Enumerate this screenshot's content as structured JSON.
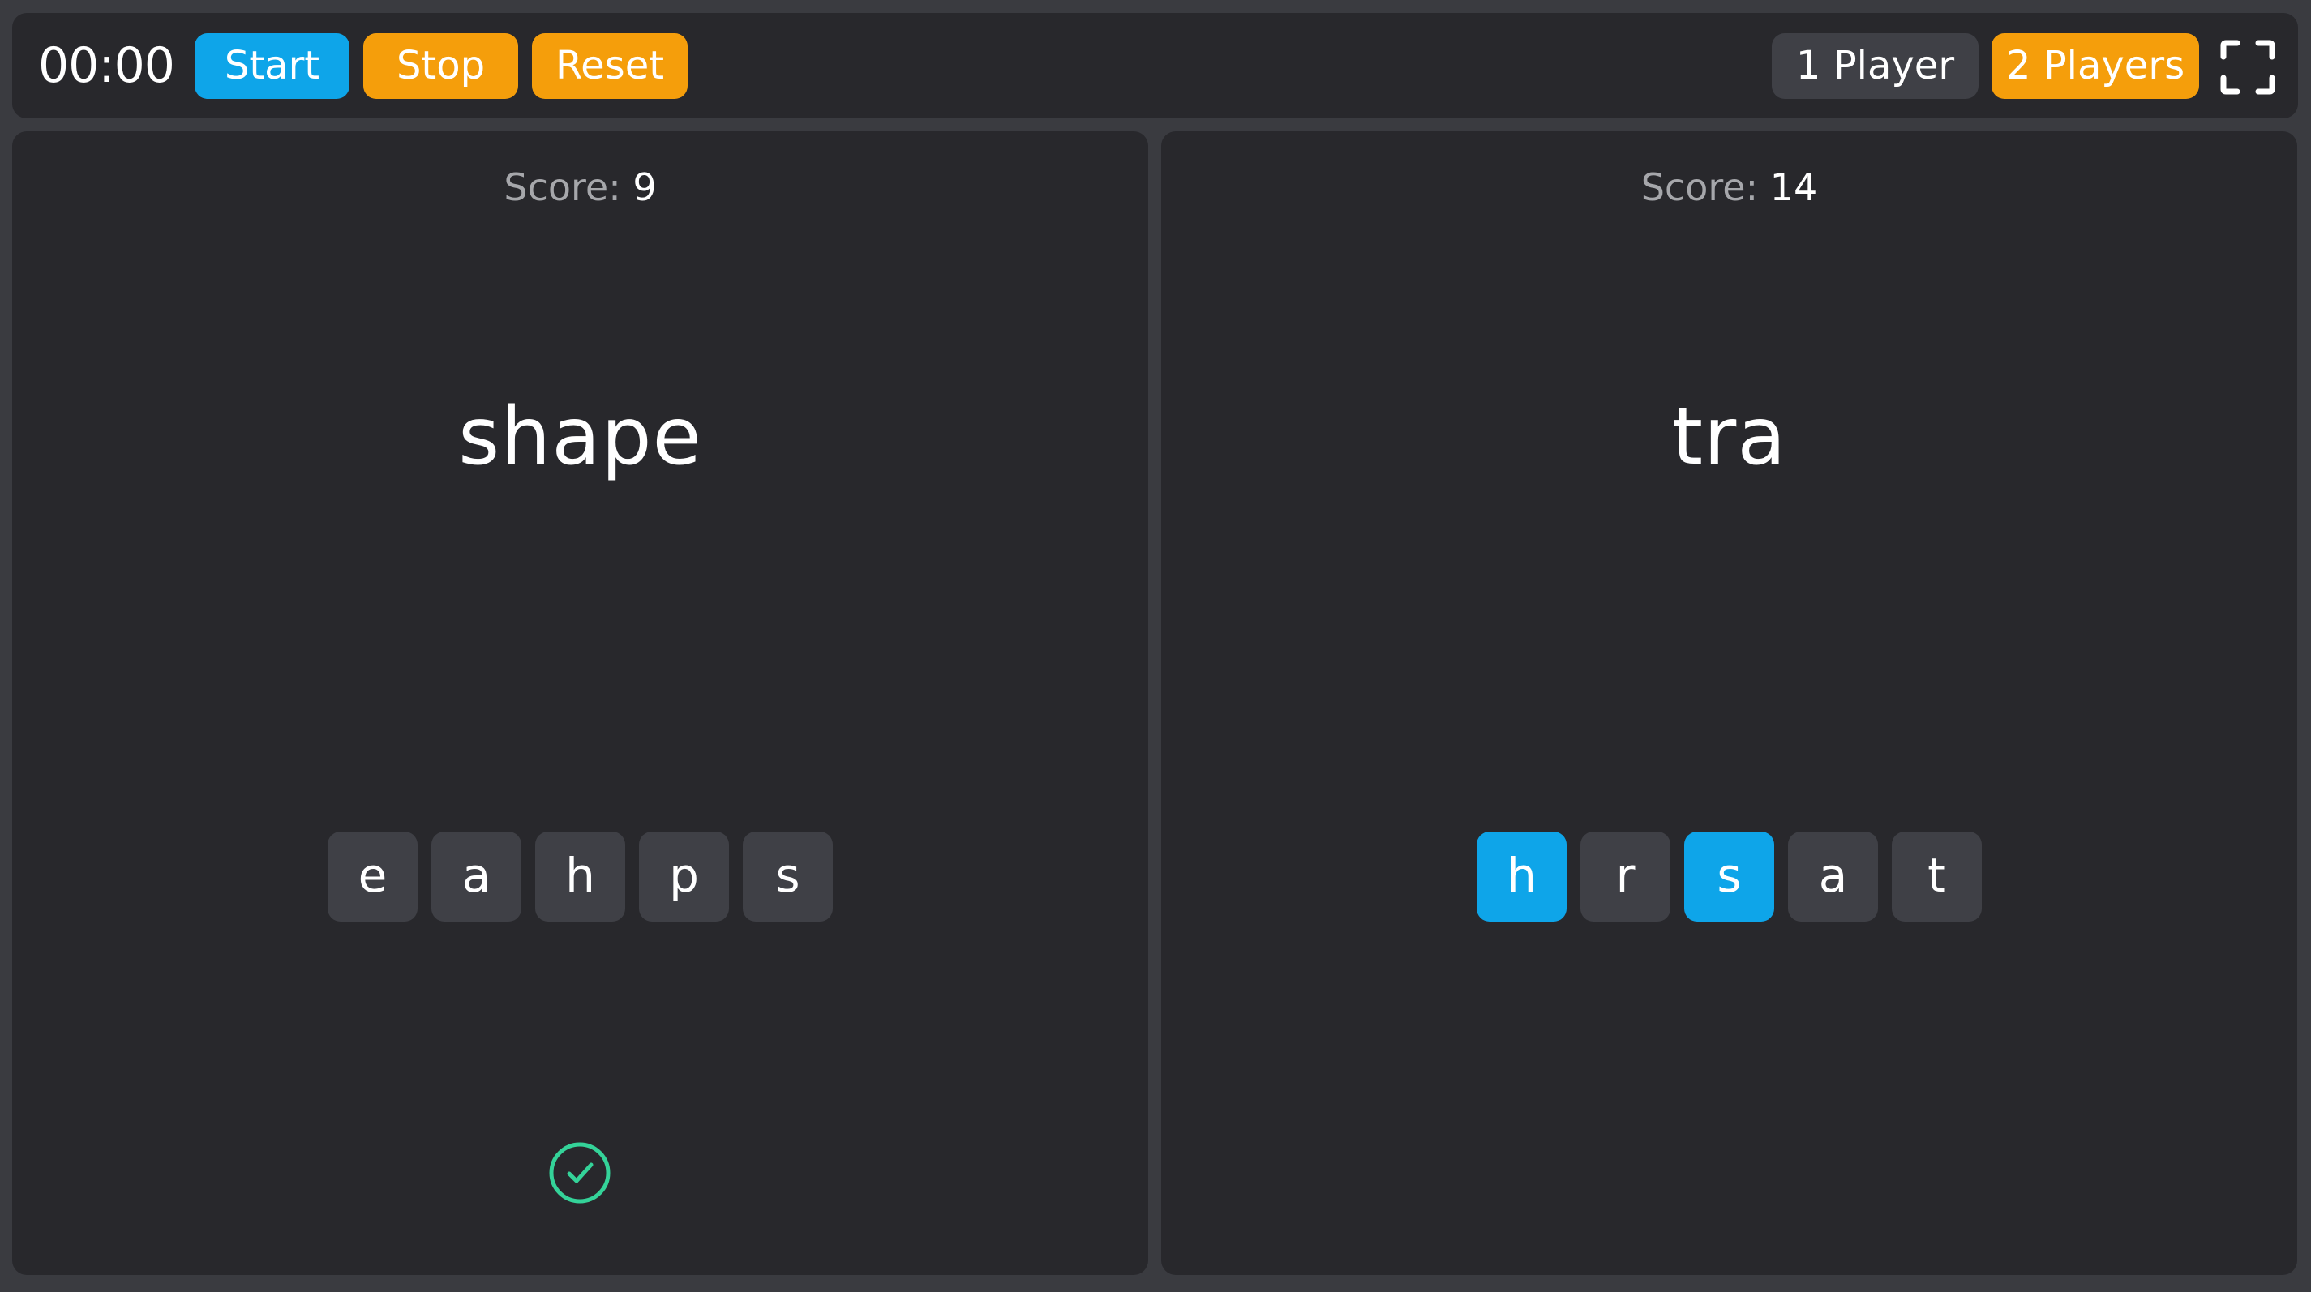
{
  "colors": {
    "accent_blue": "#0ea5e9",
    "accent_orange": "#f59e0b",
    "neutral_button": "#3f4046",
    "panel_bg": "#28282c",
    "page_bg": "#3a3b40",
    "success_green": "#34d399"
  },
  "toolbar": {
    "timer": "00:00",
    "start_label": "Start",
    "stop_label": "Stop",
    "reset_label": "Reset",
    "one_player_label": "1 Player",
    "two_players_label": "2 Players",
    "fullscreen_icon": "fullscreen-icon",
    "selected_mode": "2 Players"
  },
  "players": [
    {
      "score_label": "Score:",
      "score": "9",
      "word": "shape",
      "tiles": [
        {
          "letter": "e",
          "selected": false
        },
        {
          "letter": "a",
          "selected": false
        },
        {
          "letter": "h",
          "selected": false
        },
        {
          "letter": "p",
          "selected": false
        },
        {
          "letter": "s",
          "selected": false
        }
      ],
      "status_icon": "check-circle-icon"
    },
    {
      "score_label": "Score:",
      "score": "14",
      "word": "tra",
      "tiles": [
        {
          "letter": "h",
          "selected": true
        },
        {
          "letter": "r",
          "selected": false
        },
        {
          "letter": "s",
          "selected": true
        },
        {
          "letter": "a",
          "selected": false
        },
        {
          "letter": "t",
          "selected": false
        }
      ]
    }
  ]
}
